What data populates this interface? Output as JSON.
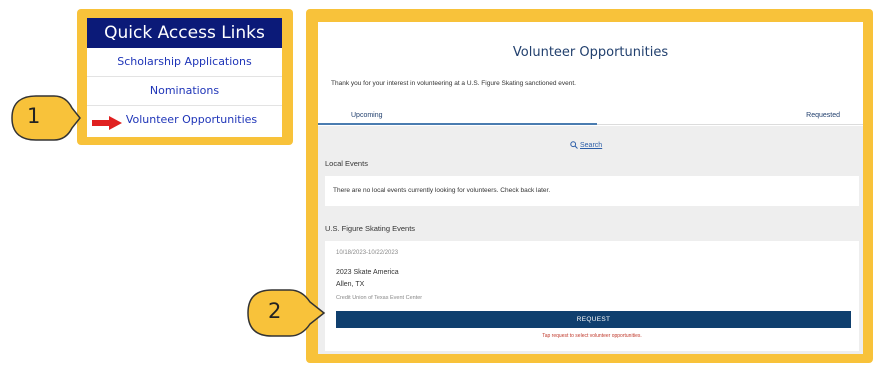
{
  "quick_access": {
    "title": "Quick Access Links",
    "links": [
      "Scholarship Applications",
      "Nominations",
      "Volunteer Opportunities"
    ]
  },
  "callouts": {
    "one": "1",
    "two": "2"
  },
  "page": {
    "title": "Volunteer Opportunities",
    "intro": "Thank you for your interest in volunteering at a U.S. Figure Skating sanctioned event.",
    "tabs": {
      "upcoming": "Upcoming",
      "requested": "Requested"
    },
    "search_label": "Search",
    "local_events": {
      "label": "Local Events",
      "empty_message": "There are no local events currently looking for volunteers. Check back later."
    },
    "usfs_events": {
      "label": "U.S. Figure Skating Events",
      "event": {
        "dates": "10/18/2023-10/22/2023",
        "name": "2023 Skate America",
        "location": "Allen, TX",
        "venue": "Credit Union of Texas Event Center",
        "request_label": "REQUEST",
        "note": "Tap request to select volunteer opportunities."
      }
    }
  },
  "colors": {
    "callout_fill": "#f8c23a",
    "header_navy": "#0b1a78",
    "button_navy": "#0f3f6e",
    "arrow_red": "#e02020"
  },
  "icons": [
    "red-arrow-icon",
    "search-icon"
  ]
}
